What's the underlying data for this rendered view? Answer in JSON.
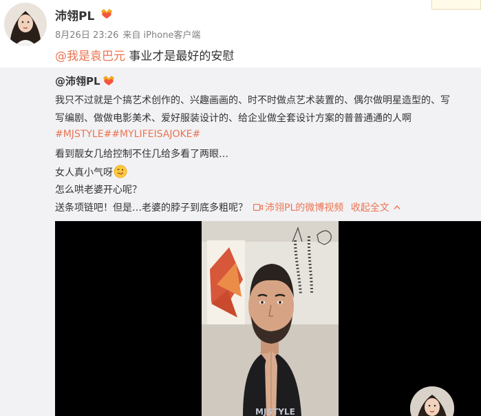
{
  "post": {
    "username": "沛翎PL",
    "date": "8月26日 23:26",
    "source": "来自 iPhone客户端",
    "mention": "@我是袁巴元",
    "text": "事业才是最好的安慰"
  },
  "repost": {
    "username": "@沛翎PL",
    "line1": "我只不过就是个搞艺术创作的、兴趣画画的、时不时做点艺术装置的、偶尔做明星造型的、写",
    "line2": "写编剧、做做电影美术、爱好服装设计的、给企业做全套设计方案的普普通通的人啊",
    "topics": "#MJSTYLE##MYLIFEISAJOKE#",
    "line4": "看到靓女几给控制不住几给多看了两眼…",
    "line5": "女人真小气呀",
    "line6": "怎么哄老婆开心呢？",
    "line7": "送条项链吧！但是…老婆的脖子到底多粗呢？",
    "video_link": "沛翎PL的微博视频",
    "collapse": "收起全文"
  },
  "video": {
    "shirt_text": "MJSTYLE"
  },
  "icons": {
    "vip_badge": "crown-heart-icon",
    "emoji": "tongue-out-emoji-icon",
    "video_link_icon": "video-camera-icon",
    "collapse_icon": "chevron-up-icon"
  },
  "colors": {
    "accent": "#eb7350",
    "repost_bg": "#f2f2f5",
    "meta": "#808080"
  }
}
